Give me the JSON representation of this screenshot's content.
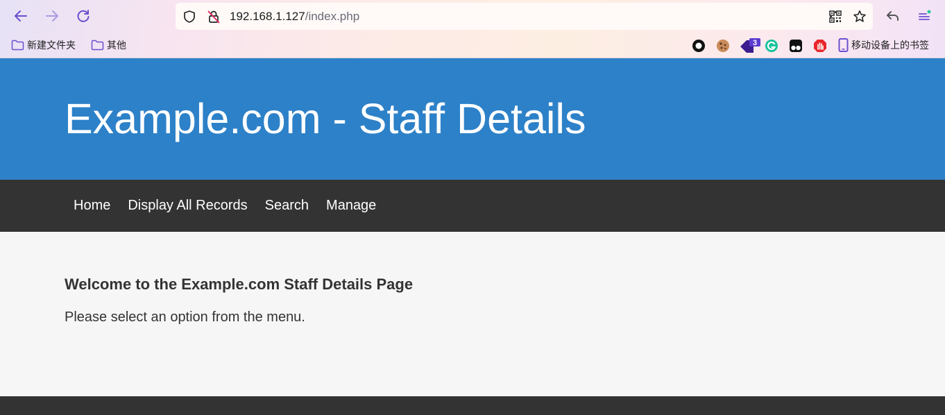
{
  "browser": {
    "url_host": "192.168.1.127",
    "url_path": "/index.php",
    "bookmarks": [
      {
        "label": "新建文件夹"
      },
      {
        "label": "其他"
      }
    ],
    "extension_badge": "3",
    "mobile_bookmarks_label": "移动设备上的书签",
    "colors": {
      "nav_icon": "#6a4fcf",
      "nav_icon_disabled": "#a99ae0"
    }
  },
  "page": {
    "site_title": "Example.com - Staff Details",
    "nav": [
      {
        "label": "Home"
      },
      {
        "label": "Display All Records"
      },
      {
        "label": "Search"
      },
      {
        "label": "Manage"
      }
    ],
    "heading": "Welcome to the Example.com Staff Details Page",
    "intro": "Please select an option from the menu.",
    "colors": {
      "header_bg": "#2d81c8",
      "nav_bg": "#333333",
      "content_bg": "#f6f6f6",
      "footer_bg": "#333333"
    }
  }
}
